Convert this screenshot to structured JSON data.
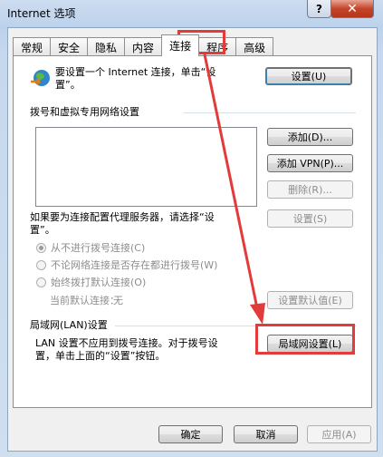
{
  "window": {
    "title": "Internet 选项",
    "help_glyph": "?",
    "close_glyph": "✕"
  },
  "tabs": [
    "常规",
    "安全",
    "隐私",
    "内容",
    "连接",
    "程序",
    "高级"
  ],
  "active_tab": "连接",
  "setup": {
    "text_line1": "要设置一个 Internet 连接，单击“设",
    "text_line2": "置”。",
    "button": "设置(U)",
    "icon": "globe-network-icon"
  },
  "dialup": {
    "header": "拨号和虚拟专用网络设置",
    "buttons": {
      "add": "添加(D)...",
      "add_vpn": "添加 VPN(P)...",
      "remove": "删除(R)...",
      "settings": "设置(S)"
    },
    "proxy_line1": "如果要为连接配置代理服务器，请选择“设",
    "proxy_line2": "置”。",
    "options": [
      "从不进行拨号连接(C)",
      "不论网络连接是否存在都进行拨号(W)",
      "始终拨打默认连接(O)"
    ],
    "selected_option": "从不进行拨号连接(C)",
    "current_default_label": "当前默认连接：",
    "current_default_value": "无",
    "set_default_button": "设置默认值(E)"
  },
  "lan": {
    "header": "局域网(LAN)设置",
    "text_line1": "LAN 设置不应用到拨号连接。对于拨号设",
    "text_line2": "置，单击上面的“设置”按钮。",
    "button": "局域网设置(L)"
  },
  "footer": {
    "ok": "确定",
    "cancel": "取消",
    "apply": "应用(A)"
  },
  "colors": {
    "highlight": "#e23b3b"
  }
}
